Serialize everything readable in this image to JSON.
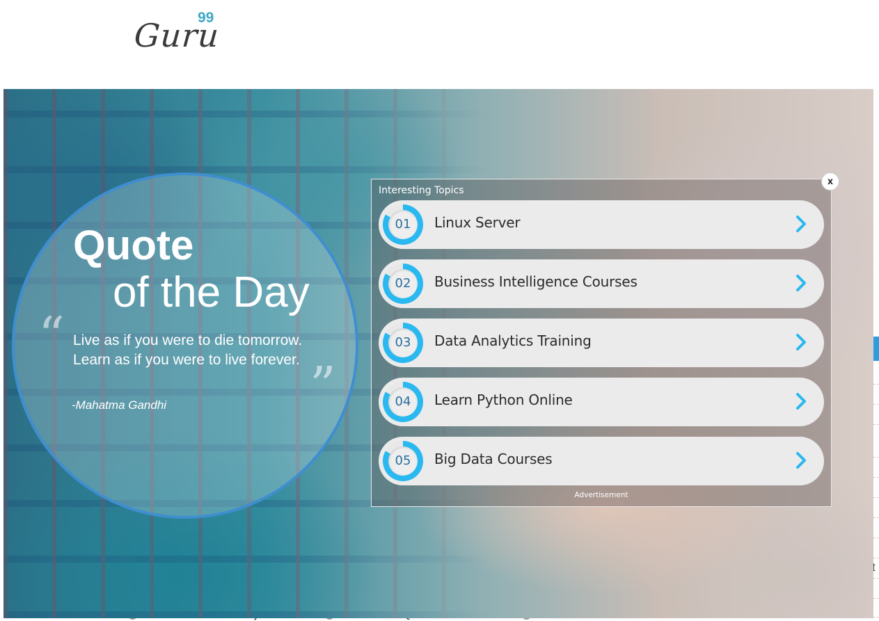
{
  "header": {
    "logo_text": "Guru",
    "logo_superscript": "99"
  },
  "quote": {
    "title_line1": "Quote",
    "title_line2": "of the Day",
    "text": "Live as if you were to die tomorrow. Learn as if you were to live forever.",
    "author": "-Mahatma Gandhi"
  },
  "topics_panel": {
    "title": "Interesting Topics",
    "close_label": "x",
    "items": [
      {
        "number": "01",
        "label": "Linux Server"
      },
      {
        "number": "02",
        "label": "Business Intelligence Courses"
      },
      {
        "number": "03",
        "label": "Data Analytics Training"
      },
      {
        "number": "04",
        "label": "Learn Python Online"
      },
      {
        "number": "05",
        "label": "Big Data Courses"
      }
    ],
    "ad_label": "Advertisement"
  },
  "background": {
    "right_letter": "t",
    "bottom_links": [
      "Live Ecommerce Project",
      "Learn SAP QM",
      "Learn JCL"
    ]
  },
  "colors": {
    "accent_blue": "#29b8ef",
    "number_blue": "#2b6e9d",
    "circle_border": "#3f8ed0",
    "logo_accent": "#3da8c4"
  }
}
